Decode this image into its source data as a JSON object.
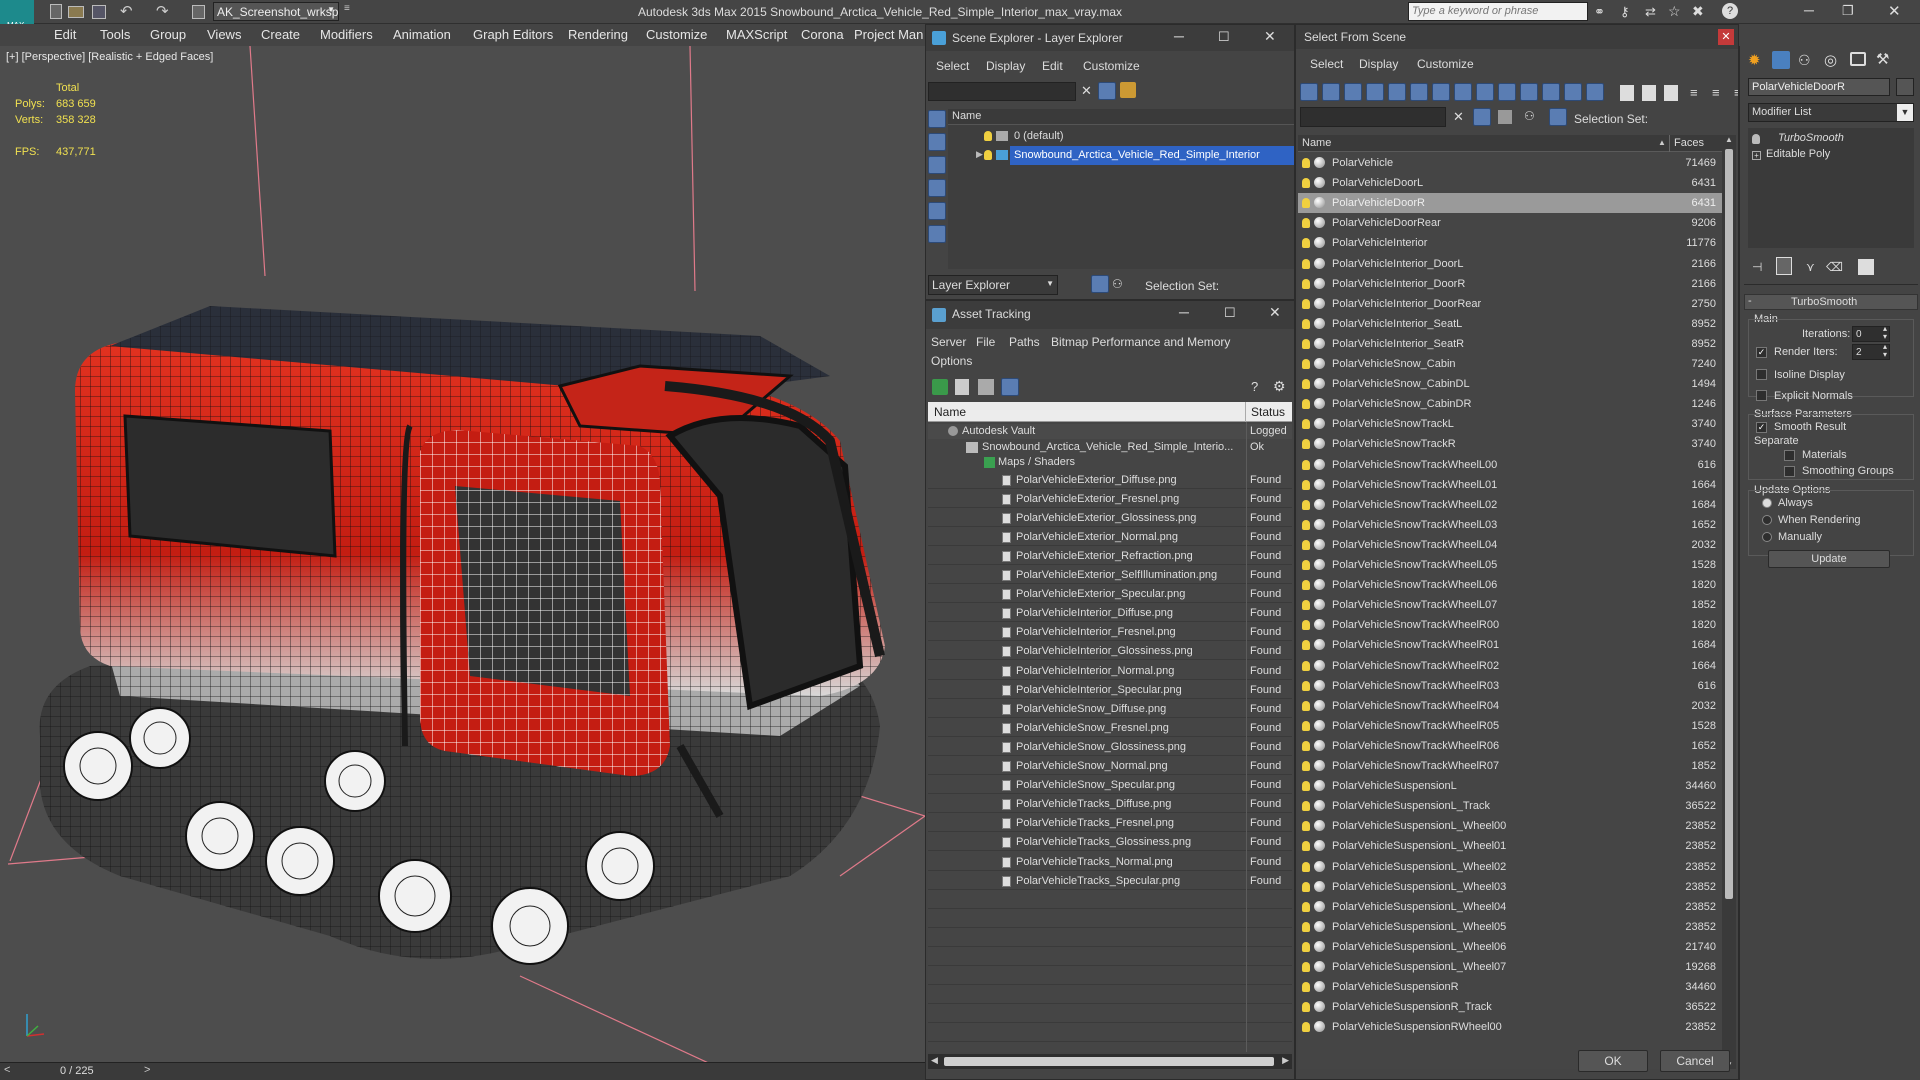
{
  "app": {
    "logo_text": "MAX",
    "workspace": "AK_Screenshot_wrksp",
    "title": "Autodesk 3ds Max  2015    Snowbound_Arctica_Vehicle_Red_Simple_Interior_max_vray.max",
    "search_placeholder": "Type a keyword or phrase"
  },
  "menu": [
    "Edit",
    "Tools",
    "Group",
    "Views",
    "Create",
    "Modifiers",
    "Animation",
    "Graph Editors",
    "Rendering",
    "Customize",
    "MAXScript",
    "Corona",
    "Project Man"
  ],
  "viewport": {
    "label": "[+] [Perspective] [Realistic + Edged Faces]",
    "stats_header": "Total",
    "polys_label": "Polys:",
    "polys_value": "683 659",
    "verts_label": "Verts:",
    "verts_value": "358 328",
    "fps_label": "FPS:",
    "fps_value": "437,771"
  },
  "timeline": {
    "frame": "0 / 225",
    "prev": "<",
    "next": ">"
  },
  "scene_explorer": {
    "title": "Scene Explorer - Layer Explorer",
    "menu": [
      "Select",
      "Display",
      "Edit",
      "Customize"
    ],
    "column_name": "Name",
    "layers": [
      "0 (default)",
      "Snowbound_Arctica_Vehicle_Red_Simple_Interior"
    ],
    "footer_label": "Layer Explorer",
    "selection_set_label": "Selection Set:"
  },
  "asset_tracking": {
    "title": "Asset Tracking",
    "menu": [
      "Server",
      "File",
      "Paths",
      "Bitmap Performance and Memory",
      "Options"
    ],
    "columns": [
      "Name",
      "Status"
    ],
    "vault": {
      "name": "Autodesk Vault",
      "status": "Logged"
    },
    "file": {
      "name": "Snowbound_Arctica_Vehicle_Red_Simple_Interio...",
      "status": "Ok"
    },
    "group": "Maps / Shaders",
    "maps": [
      "PolarVehicleExterior_Diffuse.png",
      "PolarVehicleExterior_Fresnel.png",
      "PolarVehicleExterior_Glossiness.png",
      "PolarVehicleExterior_Normal.png",
      "PolarVehicleExterior_Refraction.png",
      "PolarVehicleExterior_SelfIllumination.png",
      "PolarVehicleExterior_Specular.png",
      "PolarVehicleInterior_Diffuse.png",
      "PolarVehicleInterior_Fresnel.png",
      "PolarVehicleInterior_Glossiness.png",
      "PolarVehicleInterior_Normal.png",
      "PolarVehicleInterior_Specular.png",
      "PolarVehicleSnow_Diffuse.png",
      "PolarVehicleSnow_Fresnel.png",
      "PolarVehicleSnow_Glossiness.png",
      "PolarVehicleSnow_Normal.png",
      "PolarVehicleSnow_Specular.png",
      "PolarVehicleTracks_Diffuse.png",
      "PolarVehicleTracks_Fresnel.png",
      "PolarVehicleTracks_Glossiness.png",
      "PolarVehicleTracks_Normal.png",
      "PolarVehicleTracks_Specular.png"
    ],
    "map_status": "Found"
  },
  "select_from_scene": {
    "title": "Select From Scene",
    "menu": [
      "Select",
      "Display",
      "Customize"
    ],
    "selection_set_label": "Selection Set:",
    "columns": [
      "Name",
      "Faces"
    ],
    "selected_index": 2,
    "objects": [
      {
        "name": "PolarVehicle",
        "faces": "71469"
      },
      {
        "name": "PolarVehicleDoorL",
        "faces": "6431"
      },
      {
        "name": "PolarVehicleDoorR",
        "faces": "6431"
      },
      {
        "name": "PolarVehicleDoorRear",
        "faces": "9206"
      },
      {
        "name": "PolarVehicleInterior",
        "faces": "11776"
      },
      {
        "name": "PolarVehicleInterior_DoorL",
        "faces": "2166"
      },
      {
        "name": "PolarVehicleInterior_DoorR",
        "faces": "2166"
      },
      {
        "name": "PolarVehicleInterior_DoorRear",
        "faces": "2750"
      },
      {
        "name": "PolarVehicleInterior_SeatL",
        "faces": "8952"
      },
      {
        "name": "PolarVehicleInterior_SeatR",
        "faces": "8952"
      },
      {
        "name": "PolarVehicleSnow_Cabin",
        "faces": "7240"
      },
      {
        "name": "PolarVehicleSnow_CabinDL",
        "faces": "1494"
      },
      {
        "name": "PolarVehicleSnow_CabinDR",
        "faces": "1246"
      },
      {
        "name": "PolarVehicleSnowTrackL",
        "faces": "3740"
      },
      {
        "name": "PolarVehicleSnowTrackR",
        "faces": "3740"
      },
      {
        "name": "PolarVehicleSnowTrackWheelL00",
        "faces": "616"
      },
      {
        "name": "PolarVehicleSnowTrackWheelL01",
        "faces": "1664"
      },
      {
        "name": "PolarVehicleSnowTrackWheelL02",
        "faces": "1684"
      },
      {
        "name": "PolarVehicleSnowTrackWheelL03",
        "faces": "1652"
      },
      {
        "name": "PolarVehicleSnowTrackWheelL04",
        "faces": "2032"
      },
      {
        "name": "PolarVehicleSnowTrackWheelL05",
        "faces": "1528"
      },
      {
        "name": "PolarVehicleSnowTrackWheelL06",
        "faces": "1820"
      },
      {
        "name": "PolarVehicleSnowTrackWheelL07",
        "faces": "1852"
      },
      {
        "name": "PolarVehicleSnowTrackWheelR00",
        "faces": "1820"
      },
      {
        "name": "PolarVehicleSnowTrackWheelR01",
        "faces": "1684"
      },
      {
        "name": "PolarVehicleSnowTrackWheelR02",
        "faces": "1664"
      },
      {
        "name": "PolarVehicleSnowTrackWheelR03",
        "faces": "616"
      },
      {
        "name": "PolarVehicleSnowTrackWheelR04",
        "faces": "2032"
      },
      {
        "name": "PolarVehicleSnowTrackWheelR05",
        "faces": "1528"
      },
      {
        "name": "PolarVehicleSnowTrackWheelR06",
        "faces": "1652"
      },
      {
        "name": "PolarVehicleSnowTrackWheelR07",
        "faces": "1852"
      },
      {
        "name": "PolarVehicleSuspensionL",
        "faces": "34460"
      },
      {
        "name": "PolarVehicleSuspensionL_Track",
        "faces": "36522"
      },
      {
        "name": "PolarVehicleSuspensionL_Wheel00",
        "faces": "23852"
      },
      {
        "name": "PolarVehicleSuspensionL_Wheel01",
        "faces": "23852"
      },
      {
        "name": "PolarVehicleSuspensionL_Wheel02",
        "faces": "23852"
      },
      {
        "name": "PolarVehicleSuspensionL_Wheel03",
        "faces": "23852"
      },
      {
        "name": "PolarVehicleSuspensionL_Wheel04",
        "faces": "23852"
      },
      {
        "name": "PolarVehicleSuspensionL_Wheel05",
        "faces": "23852"
      },
      {
        "name": "PolarVehicleSuspensionL_Wheel06",
        "faces": "21740"
      },
      {
        "name": "PolarVehicleSuspensionL_Wheel07",
        "faces": "19268"
      },
      {
        "name": "PolarVehicleSuspensionR",
        "faces": "34460"
      },
      {
        "name": "PolarVehicleSuspensionR_Track",
        "faces": "36522"
      },
      {
        "name": "PolarVehicleSuspensionRWheel00",
        "faces": "23852"
      }
    ],
    "ok_label": "OK",
    "cancel_label": "Cancel"
  },
  "command_panel": {
    "object_name": "PolarVehicleDoorR",
    "modifier_list_label": "Modifier List",
    "stack": [
      "TurboSmooth",
      "Editable Poly"
    ],
    "rollout_title": "TurboSmooth",
    "main_label": "Main",
    "iterations_label": "Iterations:",
    "iterations_value": "0",
    "render_iters_label": "Render Iters:",
    "render_iters_value": "2",
    "isoline_label": "Isoline Display",
    "explicit_normals_label": "Explicit Normals",
    "surface_params_label": "Surface Parameters",
    "smooth_result_label": "Smooth Result",
    "separate_label": "Separate",
    "materials_label": "Materials",
    "smoothing_groups_label": "Smoothing Groups",
    "update_options_label": "Update Options",
    "always_label": "Always",
    "when_rendering_label": "When Rendering",
    "manually_label": "Manually",
    "update_button": "Update"
  },
  "colors": {
    "selection_blue": "#2f63c4",
    "vehicle_red": "#d42a1a",
    "logo_teal": "#1d8a8c",
    "bulb_yellow": "#f0d040"
  }
}
